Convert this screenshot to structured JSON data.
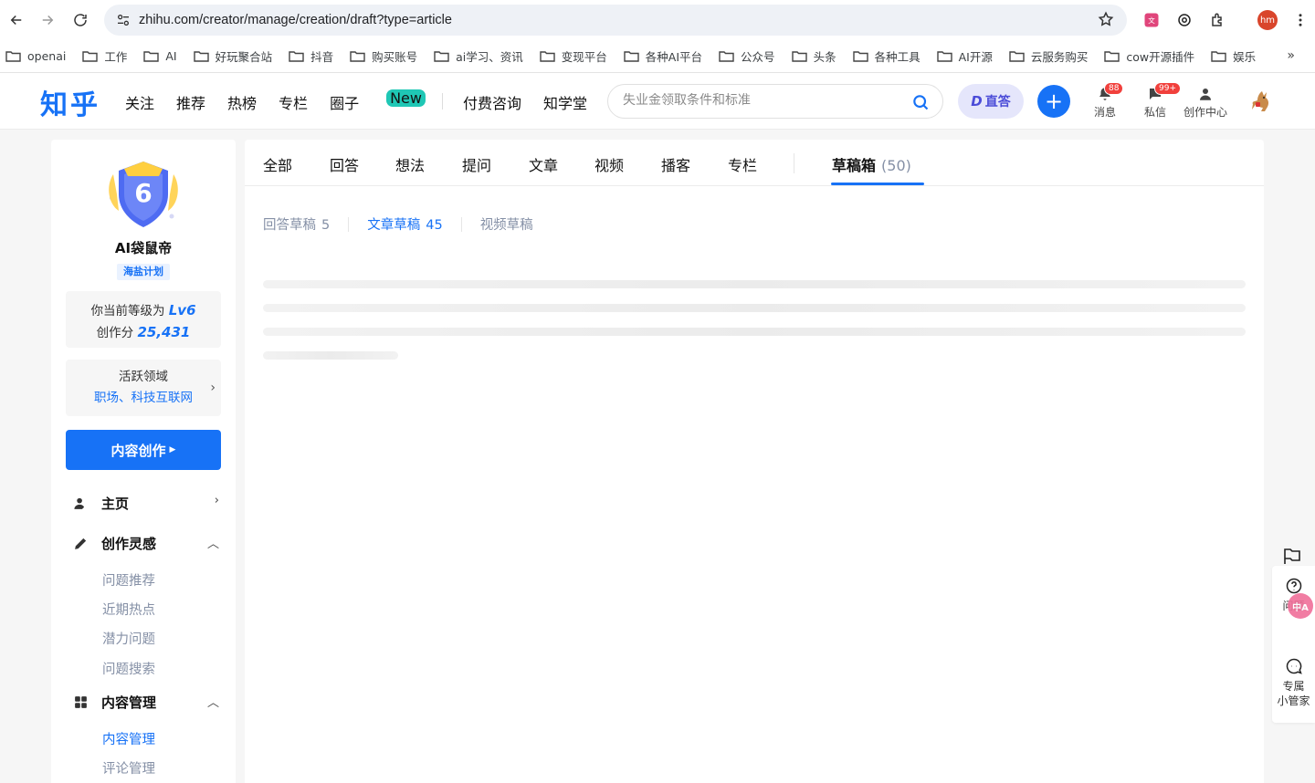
{
  "browser": {
    "url": "zhihu.com/creator/manage/creation/draft?type=article",
    "profile_initials": "hm",
    "bookmarks": [
      "openai",
      "工作",
      "AI",
      "好玩聚合站",
      "抖音",
      "购买账号",
      "ai学习、资讯",
      "变现平台",
      "各种AI平台",
      "公众号",
      "头条",
      "各种工具",
      "AI开源",
      "云服务购买",
      "cow开源插件",
      "娱乐"
    ],
    "bookmarks_more": "»"
  },
  "header": {
    "logo": "知乎",
    "nav": [
      "关注",
      "推荐",
      "热榜",
      "专栏",
      "圈子",
      "付费咨询",
      "知学堂"
    ],
    "new_badge": "New",
    "search_placeholder": "失业金领取条件和标准",
    "zhida_label": "直答",
    "zhida_d": "D",
    "plus": "+",
    "messages_label": "消息",
    "messages_badge": "88",
    "dm_label": "私信",
    "dm_badge": "99+",
    "creator_center_label": "创作中心"
  },
  "sidebar": {
    "level_number": "6",
    "user_name": "AI袋鼠帝",
    "plan_tag": "海盐计划",
    "level_text": "你当前等级为",
    "level_value": "Lv6",
    "score_text": "创作分",
    "score_value": "25,431",
    "domain_title": "活跃领域",
    "domain_value": "职场、科技互联网",
    "create_button": "内容创作",
    "menu": {
      "home": "主页",
      "inspiration": "创作灵感",
      "inspiration_items": [
        "问题推荐",
        "近期热点",
        "潜力问题",
        "问题搜索"
      ],
      "content_mgmt": "内容管理",
      "content_items": [
        "内容管理",
        "评论管理"
      ]
    }
  },
  "main": {
    "tabs": [
      "全部",
      "回答",
      "想法",
      "提问",
      "文章",
      "视频",
      "播客",
      "专栏"
    ],
    "drafts_tab": "草稿箱",
    "drafts_count": "(50)",
    "subtabs": [
      {
        "label": "回答草稿",
        "count": "5"
      },
      {
        "label": "文章草稿",
        "count": "45"
      },
      {
        "label": "视频草稿",
        "count": ""
      }
    ]
  },
  "floating": {
    "question_label": "问题",
    "assistant_label": "专属小管家",
    "assistant_line1": "专属",
    "assistant_line2": "小管家",
    "translate_text": "中A"
  }
}
